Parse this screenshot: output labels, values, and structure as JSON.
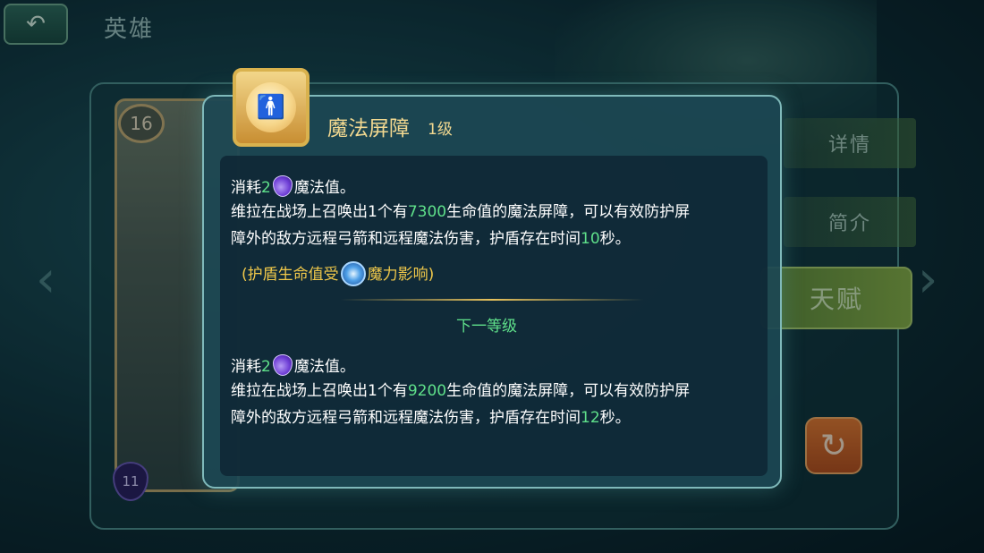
{
  "header": {
    "back_icon": "back-arrow-icon",
    "title": "英雄"
  },
  "hero_card": {
    "level": "16",
    "cost": "11"
  },
  "side_tabs": [
    {
      "label": "详情"
    },
    {
      "label": "简介"
    },
    {
      "label": "天赋",
      "active": true
    }
  ],
  "refresh_icon": "refresh-icon",
  "popup": {
    "skill_icon": "shield-orb-icon",
    "skill_name": "魔法屏障",
    "skill_level": "1级",
    "current": {
      "cost_prefix": "消耗",
      "cost_value": "2",
      "cost_suffix": "魔法值。",
      "line1_a": "维拉在战场上召唤出1个有",
      "line1_num": "7300",
      "line1_b": "生命值的魔法屏障，可以有效防护屏",
      "line2_a": "障外的敌方远程弓箭和远程魔法伤害，护盾存在时间",
      "line2_num": "10",
      "line2_b": "秒。"
    },
    "note": {
      "prefix": "(护盾生命值受",
      "suffix": "魔力影响)"
    },
    "next_level_label": "下一等级",
    "next": {
      "cost_prefix": "消耗",
      "cost_value": "2",
      "cost_suffix": "魔法值。",
      "line1_a": "维拉在战场上召唤出1个有",
      "line1_num": "9200",
      "line1_b": "生命值的魔法屏障，可以有效防护屏",
      "line2_a": "障外的敌方远程弓箭和远程魔法伤害，护盾存在时间",
      "line2_num": "12",
      "line2_b": "秒。"
    }
  },
  "colors": {
    "highlight_green": "#5fe08a",
    "note_gold": "#f0c84a",
    "title_gold": "#f1d890"
  }
}
